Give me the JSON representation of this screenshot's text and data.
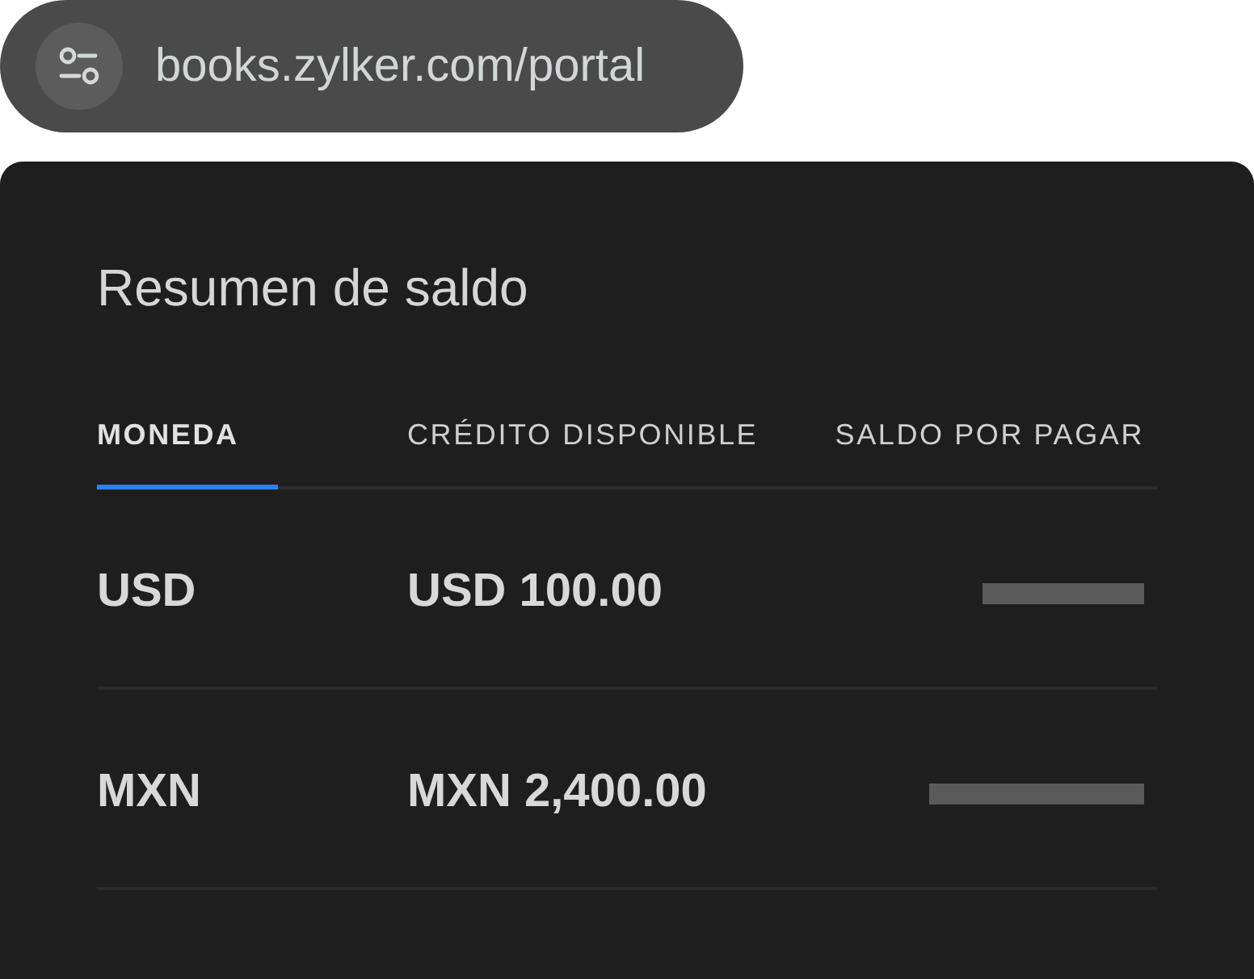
{
  "address_bar": {
    "url": "books.zylker.com/portal"
  },
  "card": {
    "title": "Resumen de saldo"
  },
  "table": {
    "columns": [
      {
        "label": "MONEDA",
        "selected": true
      },
      {
        "label": "CRÉDITO DISPONIBLE",
        "selected": false
      },
      {
        "label": "SALDO POR PAGAR",
        "selected": false
      }
    ],
    "rows": [
      {
        "currency": "USD",
        "available_credit": "USD 100.00",
        "balance_due": {
          "kind": "redacted"
        }
      },
      {
        "currency": "MXN",
        "available_credit": "MXN 2,400.00",
        "balance_due": {
          "kind": "redacted"
        }
      }
    ]
  }
}
